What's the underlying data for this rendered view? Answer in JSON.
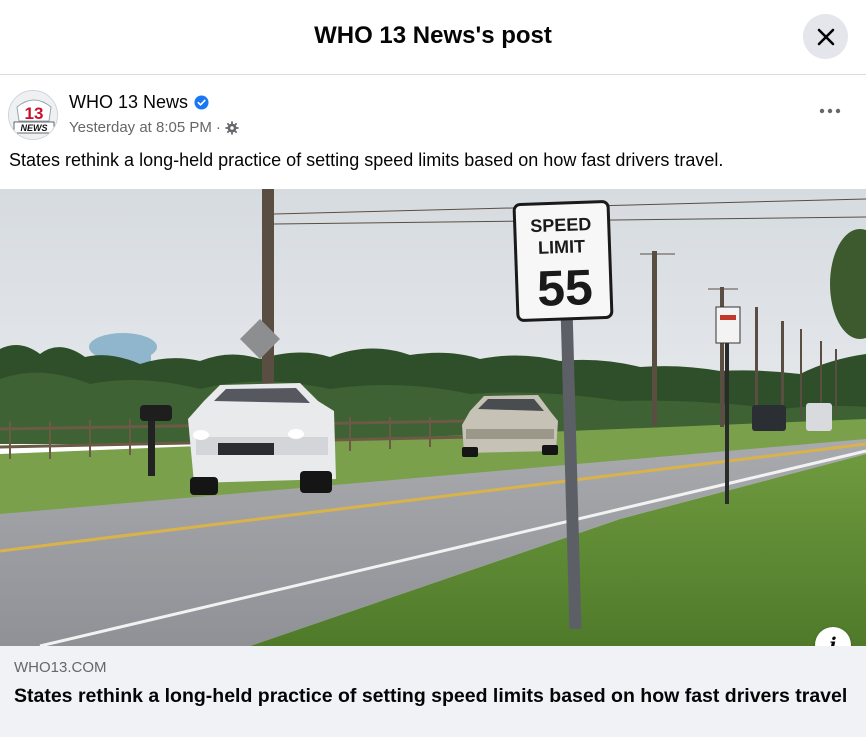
{
  "dialog": {
    "title": "WHO 13 News's post",
    "close_icon": "close-icon"
  },
  "post": {
    "author": "WHO 13 News",
    "verified": true,
    "timestamp": "Yesterday at 8:05 PM",
    "separator": "·",
    "audience_icon": "gear-icon",
    "more_icon": "more-icon",
    "caption": "States rethink a long-held practice of setting speed limits based on how fast drivers travel."
  },
  "avatar": {
    "number": "13",
    "label": "NEWS"
  },
  "photo": {
    "sign_line1": "SPEED",
    "sign_line2": "LIMIT",
    "sign_value": "55"
  },
  "link_preview": {
    "domain": "WHO13.COM",
    "title": "States rethink a long-held practice of setting speed limits based on how fast drivers travel",
    "info_label": "i"
  },
  "colors": {
    "verified_blue": "#1877f2",
    "secondary_text": "#65676b",
    "link_bg": "#f0f2f5",
    "close_bg": "#e4e6eb"
  }
}
